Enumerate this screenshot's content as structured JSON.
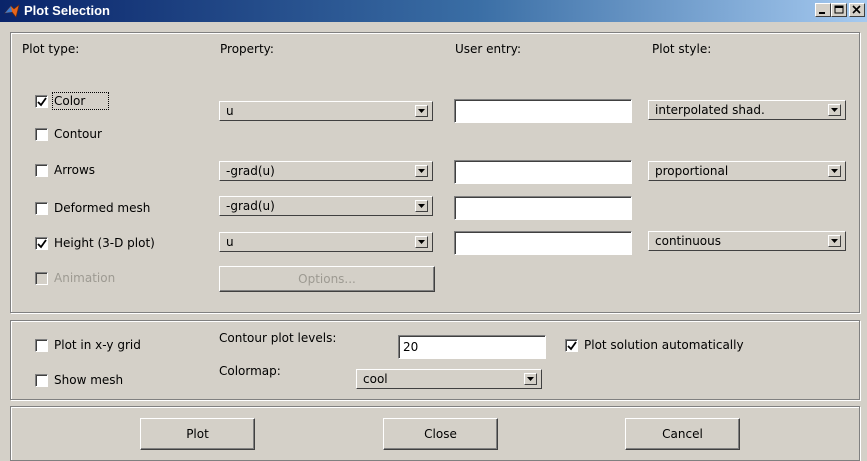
{
  "window": {
    "title": "Plot Selection"
  },
  "headers": {
    "plot_type": "Plot type:",
    "property": "Property:",
    "user_entry": "User entry:",
    "plot_style": "Plot style:"
  },
  "rows": {
    "color": {
      "label": "Color",
      "checked": true,
      "property": "u",
      "style": "interpolated shad."
    },
    "contour": {
      "label": "Contour",
      "checked": false
    },
    "arrows": {
      "label": "Arrows",
      "checked": false,
      "property": "-grad(u)",
      "style": "proportional"
    },
    "deformed": {
      "label": "Deformed mesh",
      "checked": false,
      "property": "-grad(u)"
    },
    "height": {
      "label": "Height (3-D plot)",
      "checked": true,
      "property": "u",
      "style": "continuous"
    },
    "animation": {
      "label": "Animation",
      "checked": false,
      "enabled": false,
      "options_label": "Options..."
    }
  },
  "options": {
    "xy_grid_label": "Plot in x-y grid",
    "show_mesh_label": "Show mesh",
    "contour_levels_label": "Contour plot levels:",
    "contour_levels_value": "20",
    "auto_plot_label": "Plot solution automatically",
    "auto_plot_checked": true,
    "colormap_label": "Colormap:",
    "colormap_value": "cool"
  },
  "buttons": {
    "plot": "Plot",
    "close": "Close",
    "cancel": "Cancel"
  },
  "colors": {
    "title_gradient_start": "#0a246a",
    "title_gradient_end": "#a6caf0",
    "face": "#d4d0c8"
  }
}
